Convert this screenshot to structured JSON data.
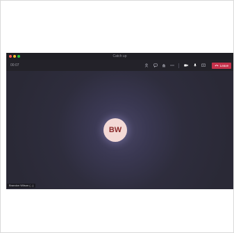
{
  "window": {
    "title": "Catch up"
  },
  "toolbar": {
    "timer": "00:07",
    "icons": [
      "people-icon",
      "chat-icon",
      "raise-hand-icon",
      "more-icon",
      "camera-icon",
      "mic-icon",
      "share-screen-icon"
    ],
    "leave_label": "Leave",
    "leave_color": "#c4314b"
  },
  "stage": {
    "avatar_initials": "BW",
    "participant_label": "Brandon Wilson (...)"
  },
  "colors": {
    "meeting_background": "#2b2a37",
    "avatar_background": "#f3d9d6",
    "avatar_text": "#8a2b2b"
  }
}
